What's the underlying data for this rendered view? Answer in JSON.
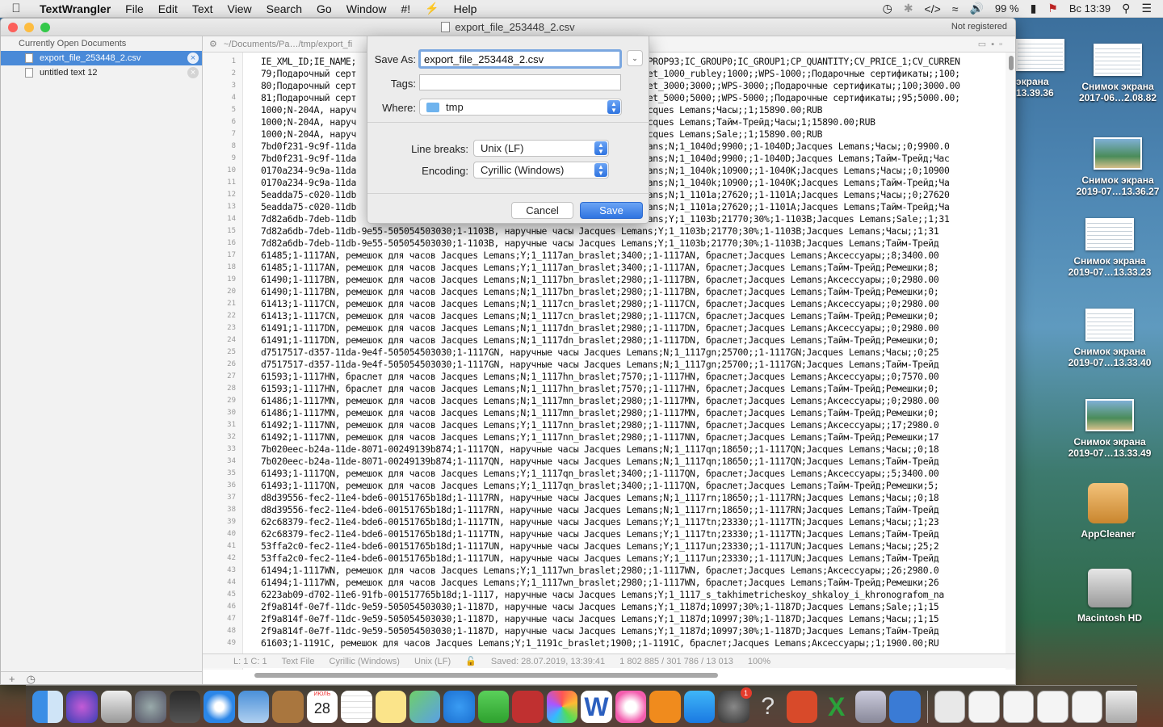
{
  "menubar": {
    "app": "TextWrangler",
    "items": [
      "File",
      "Edit",
      "Text",
      "View",
      "Search",
      "Go",
      "Window",
      "#!",
      "Help"
    ],
    "battery": "99 %",
    "clock": "Вс 13:39"
  },
  "desktop": {
    "items": [
      {
        "label": "экрана\n13.39.36"
      },
      {
        "label": "Снимок экрана\n2017-06…2.08.82"
      },
      {
        "label": "Снимок экрана\n2019-07…13.36.27"
      },
      {
        "label": "Снимок экрана\n2019-07…13.33.23"
      },
      {
        "label": "Снимок экрана\n2019-07…13.33.40"
      },
      {
        "label": "Снимок экрана\n2019-07…13.33.49"
      },
      {
        "label": "AppCleaner"
      },
      {
        "label": "Macintosh HD"
      }
    ]
  },
  "window": {
    "title": "export_file_253448_2.csv",
    "not_registered": "Not registered",
    "path": "~/Documents/Pa…/tmp/export_fi",
    "sidebar": {
      "header": "Currently Open Documents",
      "docs": [
        "export_file_253448_2.csv",
        "untitled text 12"
      ]
    },
    "status": {
      "pos": "L: 1 C: 1",
      "type": "Text File",
      "encoding": "Cyrillic (Windows)",
      "linebreaks": "Unix (LF)",
      "saved": "Saved: 28.07.2019, 13:39:41",
      "size": "1 802 885 / 301 786 / 13 013",
      "zoom": "100%"
    }
  },
  "editor": {
    "line_numbers": [
      "1",
      "2",
      "3",
      "4",
      "5",
      "6",
      "7",
      "8",
      "9",
      "10",
      "11",
      "12",
      "13",
      "14",
      "15",
      "16",
      "17",
      "18",
      "19",
      "20",
      "21",
      "22",
      "23",
      "24",
      "25",
      "26",
      "27",
      "28",
      "29",
      "30",
      "31",
      "32",
      "33",
      "34",
      "35",
      "36",
      "37",
      "38",
      "39",
      "40",
      "41",
      "42",
      "43",
      "44",
      "45",
      "46",
      "47",
      "48",
      "49"
    ],
    "lines": [
      "IE_XML_ID;IE_NAME;                                                    IP_PROP93;IC_GROUP0;IC_GROUP1;CP_QUANTITY;CV_PRICE_1;CV_CURREN",
      "79;Подарочный серт                                                    lanet_1000_rubley;1000;;WPS-1000;;Подарочные сертификаты;;100;",
      "80;Подарочный серт                                                    lanet_3000;3000;;WPS-3000;;Подарочные сертификаты;;100;3000.00",
      "81;Подарочный серт                                                    lanet_5000;5000;;WPS-5000;;Подарочные сертификаты;;95;5000.00;",
      "1000;N-204A, наруч                                                    ;Jacques Lemans;Часы;;1;15890.00;RUB",
      "1000;N-204A, наруч                                                    ;Jacques Lemans;Тайм-Трейд;Часы;1;15890.00;RUB",
      "1000;N-204A, наруч                                                    ;Jacques Lemans;Sale;;1;15890.00;RUB",
      "7bd0f231-9c9f-11da                                                    Lemans;N;1_1040d;9900;;1-1040D;Jacques Lemans;Часы;;0;9900.0",
      "7bd0f231-9c9f-11da                                                    Lemans;N;1_1040d;9900;;1-1040D;Jacques Lemans;Тайм-Трейд;Час",
      "0170a234-9c9a-11da                                                    Lemans;N;1_1040k;10900;;1-1040K;Jacques Lemans;Часы;;0;10900",
      "0170a234-9c9a-11da                                                    Lemans;N;1_1040k;10900;;1-1040K;Jacques Lemans;Тайм-Трейд;Ча",
      "5eadda75-c020-11db                                                    Lemans;N;1_1101a;27620;;1-1101A;Jacques Lemans;Часы;;0;27620",
      "5eadda75-c020-11db                                                    Lemans;N;1_1101a;27620;;1-1101A;Jacques Lemans;Тайм-Трейд;Ча",
      "7d82a6db-7deb-11db                                                    Lemans;Y;1_1103b;21770;30%;1-1103B;Jacques Lemans;Sale;;1;31",
      "7d82a6db-7deb-11db-9e55-505054503030;1-1103B, наручные часы Jacques Lemans;Y;1_1103b;21770;30%;1-1103B;Jacques Lemans;Часы;;1;31",
      "7d82a6db-7deb-11db-9e55-505054503030;1-1103B, наручные часы Jacques Lemans;Y;1_1103b;21770;30%;1-1103B;Jacques Lemans;Тайм-Трейд",
      "61485;1-1117AN, ремешок для часов Jacques Lemans;Y;1_1117an_braslet;3400;;1-1117AN, браслет;Jacques Lemans;Аксессуары;;8;3400.00",
      "61485;1-1117AN, ремешок для часов Jacques Lemans;Y;1_1117an_braslet;3400;;1-1117AN, браслет;Jacques Lemans;Тайм-Трейд;Ремешки;8;",
      "61490;1-1117BN, ремешок для часов Jacques Lemans;N;1_1117bn_braslet;2980;;1-1117BN, браслет;Jacques Lemans;Аксессуары;;0;2980.00",
      "61490;1-1117BN, ремешок для часов Jacques Lemans;N;1_1117bn_braslet;2980;;1-1117BN, браслет;Jacques Lemans;Тайм-Трейд;Ремешки;0;",
      "61413;1-1117CN, ремешок для часов Jacques Lemans;N;1_1117cn_braslet;2980;;1-1117CN, браслет;Jacques Lemans;Аксессуары;;0;2980.00",
      "61413;1-1117CN, ремешок для часов Jacques Lemans;N;1_1117cn_braslet;2980;;1-1117CN, браслет;Jacques Lemans;Тайм-Трейд;Ремешки;0;",
      "61491;1-1117DN, ремешок для часов Jacques Lemans;N;1_1117dn_braslet;2980;;1-1117DN, браслет;Jacques Lemans;Аксессуары;;0;2980.00",
      "61491;1-1117DN, ремешок для часов Jacques Lemans;N;1_1117dn_braslet;2980;;1-1117DN, браслет;Jacques Lemans;Тайм-Трейд;Ремешки;0;",
      "d7517517-d357-11da-9e4f-505054503030;1-1117GN, наручные часы Jacques Lemans;N;1_1117gn;25700;;1-1117GN;Jacques Lemans;Часы;;0;25",
      "d7517517-d357-11da-9e4f-505054503030;1-1117GN, наручные часы Jacques Lemans;N;1_1117gn;25700;;1-1117GN;Jacques Lemans;Тайм-Трейд",
      "61593;1-1117HN, браслет для часов Jacques Lemans;N;1_1117hn_braslet;7570;;1-1117HN, браслет;Jacques Lemans;Аксессуары;;0;7570.00",
      "61593;1-1117HN, браслет для часов Jacques Lemans;N;1_1117hn_braslet;7570;;1-1117HN, браслет;Jacques Lemans;Тайм-Трейд;Ремешки;0;",
      "61486;1-1117MN, ремешок для часов Jacques Lemans;N;1_1117mn_braslet;2980;;1-1117MN, браслет;Jacques Lemans;Аксессуары;;0;2980.00",
      "61486;1-1117MN, ремешок для часов Jacques Lemans;N;1_1117mn_braslet;2980;;1-1117MN, браслет;Jacques Lemans;Тайм-Трейд;Ремешки;0;",
      "61492;1-1117NN, ремешок для часов Jacques Lemans;Y;1_1117nn_braslet;2980;;1-1117NN, браслет;Jacques Lemans;Аксессуары;;17;2980.0",
      "61492;1-1117NN, ремешок для часов Jacques Lemans;Y;1_1117nn_braslet;2980;;1-1117NN, браслет;Jacques Lemans;Тайм-Трейд;Ремешки;17",
      "7b020eec-b24a-11de-8071-00249139b874;1-1117QN, наручные часы Jacques Lemans;N;1_1117qn;18650;;1-1117QN;Jacques Lemans;Часы;;0;18",
      "7b020eec-b24a-11de-8071-00249139b874;1-1117QN, наручные часы Jacques Lemans;N;1_1117qn;18650;;1-1117QN;Jacques Lemans;Тайм-Трейд",
      "61493;1-1117QN, ремешок для часов Jacques Lemans;Y;1_1117qn_braslet;3400;;1-1117QN, браслет;Jacques Lemans;Аксессуары;;5;3400.00",
      "61493;1-1117QN, ремешок для часов Jacques Lemans;Y;1_1117qn_braslet;3400;;1-1117QN, браслет;Jacques Lemans;Тайм-Трейд;Ремешки;5;",
      "d8d39556-fec2-11e4-bde6-00151765b18d;1-1117RN, наручные часы Jacques Lemans;N;1_1117rn;18650;;1-1117RN;Jacques Lemans;Часы;;0;18",
      "d8d39556-fec2-11e4-bde6-00151765b18d;1-1117RN, наручные часы Jacques Lemans;N;1_1117rn;18650;;1-1117RN;Jacques Lemans;Тайм-Трейд",
      "62c68379-fec2-11e4-bde6-00151765b18d;1-1117TN, наручные часы Jacques Lemans;Y;1_1117tn;23330;;1-1117TN;Jacques Lemans;Часы;;1;23",
      "62c68379-fec2-11e4-bde6-00151765b18d;1-1117TN, наручные часы Jacques Lemans;Y;1_1117tn;23330;;1-1117TN;Jacques Lemans;Тайм-Трейд",
      "53ffa2c0-fec2-11e4-bde6-00151765b18d;1-1117UN, наручные часы Jacques Lemans;Y;1_1117un;23330;;1-1117UN;Jacques Lemans;Часы;;25;2",
      "53ffa2c0-fec2-11e4-bde6-00151765b18d;1-1117UN, наручные часы Jacques Lemans;Y;1_1117un;23330;;1-1117UN;Jacques Lemans;Тайм-Трейд",
      "61494;1-1117WN, ремешок для часов Jacques Lemans;Y;1_1117wn_braslet;2980;;1-1117WN, браслет;Jacques Lemans;Аксессуары;;26;2980.0",
      "61494;1-1117WN, ремешок для часов Jacques Lemans;Y;1_1117wn_braslet;2980;;1-1117WN, браслет;Jacques Lemans;Тайм-Трейд;Ремешки;26",
      "6223ab09-d702-11e6-91fb-001517765b18d;1-1117, наручные часы Jacques Lemans;Y;1_1117_s_takhimetricheskoy_shkaloy_i_khronografom_na",
      "2f9a814f-0e7f-11dc-9e59-505054503030;1-1187D, наручные часы Jacques Lemans;Y;1_1187d;10997;30%;1-1187D;Jacques Lemans;Sale;;1;15",
      "2f9a814f-0e7f-11dc-9e59-505054503030;1-1187D, наручные часы Jacques Lemans;Y;1_1187d;10997;30%;1-1187D;Jacques Lemans;Часы;;1;15",
      "2f9a814f-0e7f-11dc-9e59-505054503030;1-1187D, наручные часы Jacques Lemans;Y;1_1187d;10997;30%;1-1187D;Jacques Lemans;Тайм-Трейд",
      "61603;1-1191C, ремешок для часов Jacques Lemans;Y;1_1191c_braslet;1900;;1-1191C, браслет;Jacques Lemans;Аксессуары;;1;1900.00;RU"
    ]
  },
  "save_dialog": {
    "save_as_label": "Save As:",
    "save_as_value": "export_file_253448_2.csv",
    "tags_label": "Tags:",
    "tags_value": "",
    "where_label": "Where:",
    "where_value": "tmp",
    "linebreaks_label": "Line breaks:",
    "linebreaks_value": "Unix (LF)",
    "encoding_label": "Encoding:",
    "encoding_value": "Cyrillic (Windows)",
    "cancel": "Cancel",
    "save": "Save"
  },
  "dock": {
    "calendar_month": "ИЮЛЬ",
    "calendar_day": "28",
    "badge": "1"
  }
}
